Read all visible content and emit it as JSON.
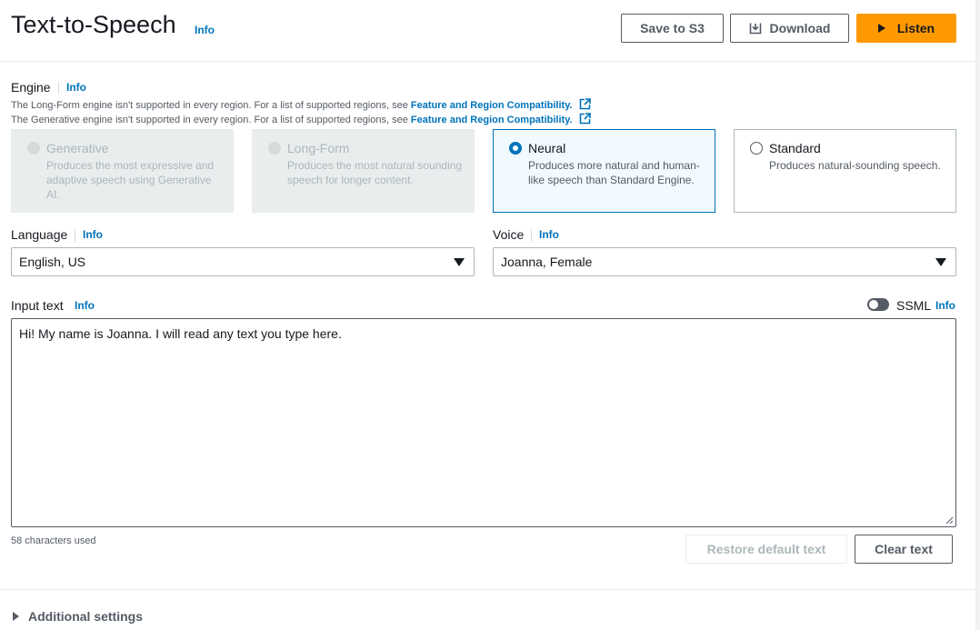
{
  "header": {
    "title": "Text-to-Speech",
    "info": "Info",
    "save_label": "Save to S3",
    "download_label": "Download",
    "listen_label": "Listen",
    "listen_color": "#ff9900"
  },
  "engine": {
    "label": "Engine",
    "info": "Info",
    "notes": [
      {
        "text": "The Long-Form engine isn't supported in every region. For a list of supported regions, see ",
        "link": "Feature and Region Compatibility."
      },
      {
        "text": "The Generative engine isn't supported in every region. For a list of supported regions, see ",
        "link": "Feature and Region Compatibility."
      }
    ],
    "options": [
      {
        "name": "Generative",
        "desc": "Produces the most expressive and adaptive speech using Generative AI.",
        "state": "disabled"
      },
      {
        "name": "Long-Form",
        "desc": "Produces the most natural sounding speech for longer content.",
        "state": "disabled"
      },
      {
        "name": "Neural",
        "desc": "Produces more natural and human-like speech than Standard Engine.",
        "state": "selected"
      },
      {
        "name": "Standard",
        "desc": "Produces natural-sounding speech.",
        "state": "unselected"
      }
    ]
  },
  "language": {
    "label": "Language",
    "info": "Info",
    "value": "English, US"
  },
  "voice": {
    "label": "Voice",
    "info": "Info",
    "value": "Joanna, Female"
  },
  "input": {
    "label": "Input text",
    "info": "Info",
    "ssml_label": "SSML",
    "ssml_info": "Info",
    "ssml_enabled": false,
    "text": "Hi! My name is Joanna. I will read any text you type here.",
    "count": "58 characters used",
    "restore_label": "Restore default text",
    "clear_label": "Clear text"
  },
  "additional": {
    "label": "Additional settings"
  },
  "icons": [
    "download-icon",
    "play-icon",
    "external-link-icon",
    "dropdown-caret-icon",
    "expand-triangle-icon"
  ]
}
